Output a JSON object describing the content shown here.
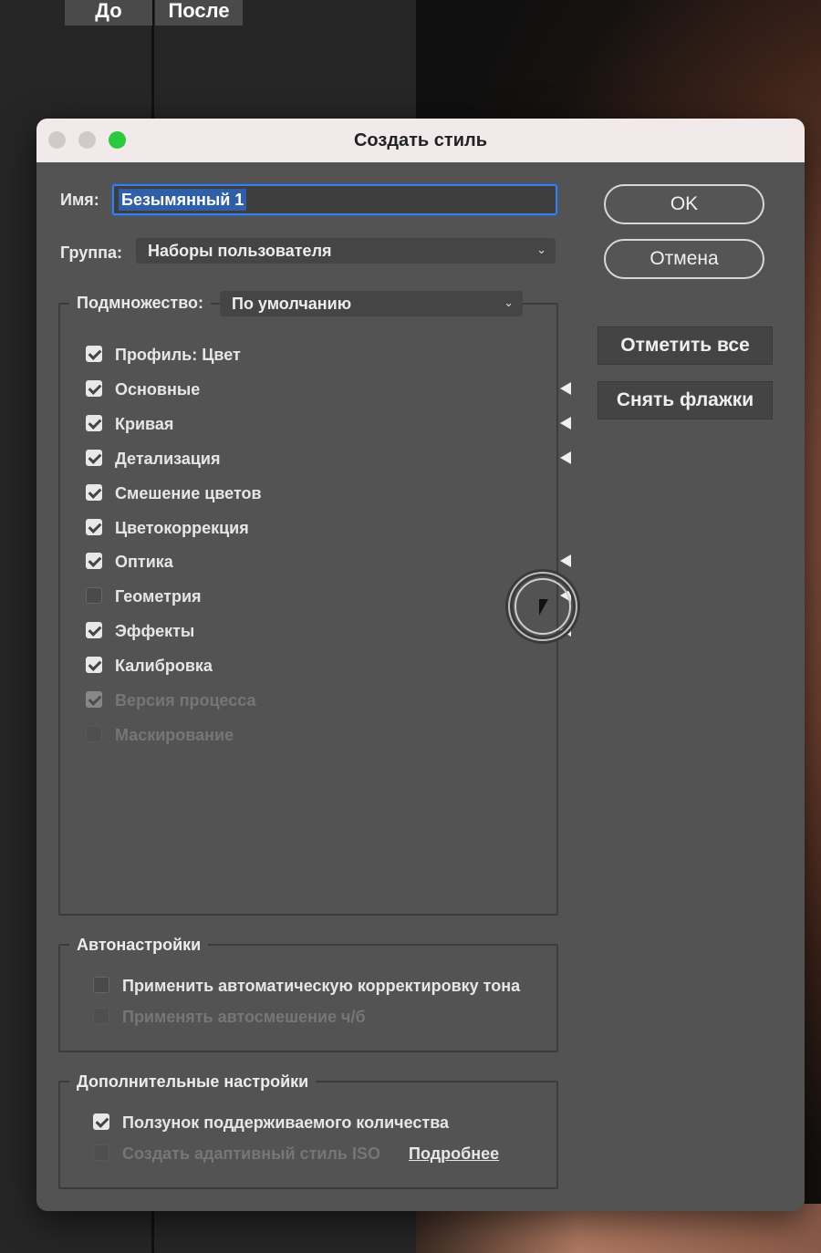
{
  "background": {
    "before_label": "До",
    "after_label": "После"
  },
  "dialog": {
    "title": "Создать стиль",
    "name_label": "Имя:",
    "name_value": "Безымянный 1",
    "group_label": "Группа:",
    "group_value": "Наборы пользователя",
    "subset_label": "Подмножество:",
    "subset_value": "По умолчанию",
    "buttons": {
      "ok": "OK",
      "cancel": "Отмена",
      "check_all": "Отметить все",
      "uncheck_all": "Снять флажки"
    },
    "settings": [
      {
        "label": "Профиль: Цвет",
        "checked": true,
        "disabled": false,
        "has_arrow": false
      },
      {
        "label": "Основные",
        "checked": true,
        "disabled": false,
        "has_arrow": true
      },
      {
        "label": "Кривая",
        "checked": true,
        "disabled": false,
        "has_arrow": true
      },
      {
        "label": "Детализация",
        "checked": true,
        "disabled": false,
        "has_arrow": true
      },
      {
        "label": "Смешение цветов",
        "checked": true,
        "disabled": false,
        "has_arrow": false
      },
      {
        "label": "Цветокоррекция",
        "checked": true,
        "disabled": false,
        "has_arrow": false
      },
      {
        "label": "Оптика",
        "checked": true,
        "disabled": false,
        "has_arrow": true
      },
      {
        "label": "Геометрия",
        "checked": false,
        "disabled": false,
        "has_arrow": true
      },
      {
        "label": "Эффекты",
        "checked": true,
        "disabled": false,
        "has_arrow": true
      },
      {
        "label": "Калибровка",
        "checked": true,
        "disabled": false,
        "has_arrow": false
      },
      {
        "label": "Версия процесса",
        "checked": true,
        "disabled": true,
        "has_arrow": false
      },
      {
        "label": "Маскирование",
        "checked": false,
        "disabled": true,
        "has_arrow": false
      }
    ],
    "auto": {
      "title": "Автонастройки",
      "items": [
        {
          "label": "Применить автоматическую корректировку тона",
          "checked": false,
          "disabled": false
        },
        {
          "label": "Применять автосмешение ч/б",
          "checked": false,
          "disabled": true
        }
      ]
    },
    "advanced": {
      "title": "Дополнительные настройки",
      "items": [
        {
          "label": "Ползунок поддерживаемого количества",
          "checked": true,
          "disabled": false
        },
        {
          "label": "Создать адаптивный стиль ISO",
          "checked": false,
          "disabled": true
        }
      ],
      "link": "Подробнее"
    }
  }
}
